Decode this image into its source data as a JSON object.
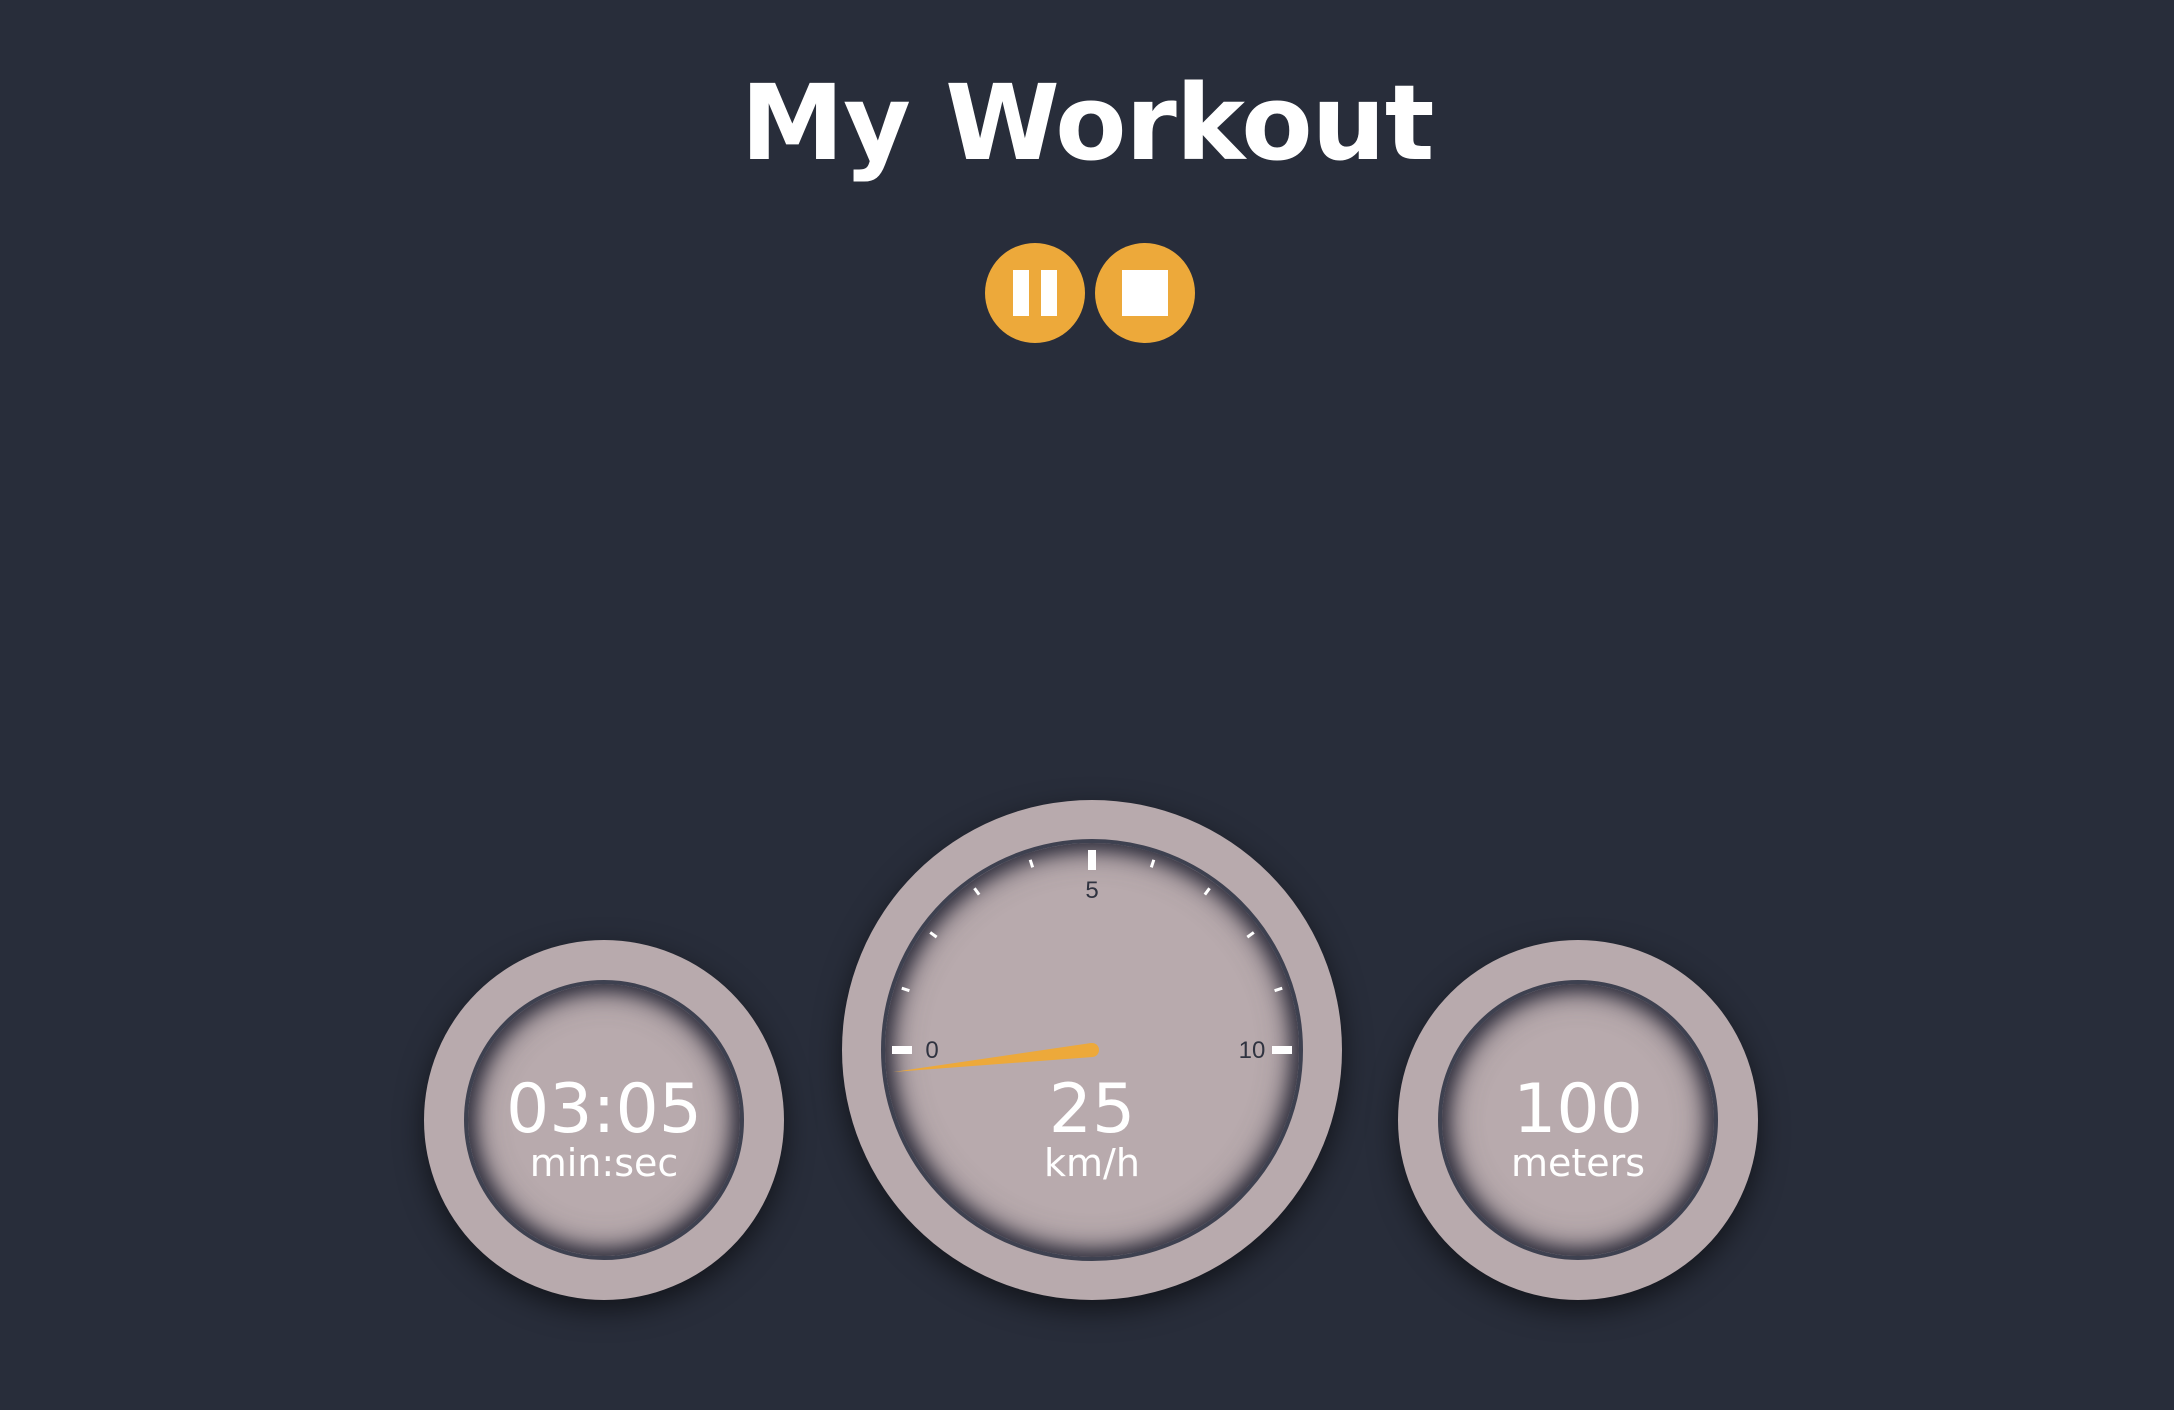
{
  "header": {
    "title": "My Workout"
  },
  "controls": {
    "pause_icon": "pause-icon",
    "stop_icon": "stop-icon",
    "accent_color": "#eda93a"
  },
  "gauges": {
    "timer": {
      "value": "03:05",
      "unit": "min:sec"
    },
    "speed": {
      "value": "25",
      "unit": "km/h",
      "scale_min": 0,
      "scale_max": 10,
      "tick_labels": [
        "0",
        "5",
        "10"
      ],
      "needle_reading": -0.35
    },
    "distance": {
      "value": "100",
      "unit": "meters"
    },
    "face_color": "#b8aaad",
    "text_color": "#ffffff"
  },
  "colors": {
    "background": "#282d3a",
    "accent": "#eda93a",
    "gauge_face": "#b8aaad"
  }
}
